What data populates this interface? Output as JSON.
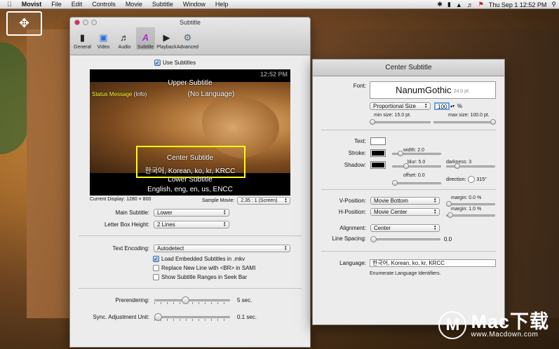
{
  "menubar": {
    "apple": "",
    "app": "Movist",
    "items": [
      "File",
      "Edit",
      "Controls",
      "Movie",
      "Subtitle",
      "Window",
      "Help"
    ],
    "clock": "Thu Sep 1  12:52 PM",
    "right_icons": [
      "bluetooth-icon",
      "battery-icon",
      "airplay-icon",
      "volume-icon",
      "flag-icon",
      "spotlight-icon"
    ]
  },
  "subtitle_window": {
    "title": "Subtitle",
    "toolbar": [
      {
        "label": "General",
        "icon": "switch-icon"
      },
      {
        "label": "Video",
        "icon": "monitor-icon"
      },
      {
        "label": "Audio",
        "icon": "speaker-icon"
      },
      {
        "label": "Subtitle",
        "icon": "subtitle-icon"
      },
      {
        "label": "Playback",
        "icon": "play-icon"
      },
      {
        "label": "Advanced",
        "icon": "gear-icon"
      }
    ],
    "use_subtitles": "Use Subtitles",
    "preview": {
      "clock": "12:52 PM",
      "upper": "Upper Subtitle",
      "upper2": "(No Language)",
      "status": "Status Message",
      "status_info": "(Info)",
      "center": "Center Subtitle",
      "center2": "한국어, Korean, ko, kr, KRCC",
      "lower": "Lower Subtitle",
      "lower2": "English, eng, en, us, ENCC"
    },
    "current_display": "Current Display: 1280 × 800",
    "sample_movie_label": "Sample Movie:",
    "sample_movie_value": "2.35 : 1 (Screen)",
    "main_subtitle_label": "Main Subtitle:",
    "main_subtitle_value": "Lower",
    "letterbox_label": "Letter Box Height:",
    "letterbox_value": "2 Lines",
    "encoding_label": "Text Encoding:",
    "encoding_value": "Autodetect",
    "load_mkv": "Load Embedded Subtitles in .mkv",
    "replace_br": "Replace New Line with <BR> in SAMI",
    "show_ranges": "Show Subtitle Ranges in Seek Bar",
    "prerendering_label": "Prerendering:",
    "prerendering_value": "5 sec.",
    "prerendering_level": 0.4,
    "sync_label": "Sync. Adjustment Unit:",
    "sync_value": "0.1 sec.",
    "sync_level": 0.0
  },
  "center_panel": {
    "title": "Center Subtitle",
    "font_label": "Font:",
    "font_name": "NanumGothic",
    "font_size": "24.0 pt.",
    "size_mode": "Proportional Size",
    "size_value": "100",
    "percent": "%",
    "min_size": "min size: 15.0 pt.",
    "max_size": "max size: 100.0 pt.",
    "text_label": "Text:",
    "stroke_label": "Stroke:",
    "shadow_label": "Shadow:",
    "text_color": "#ffffff",
    "stroke_color": "#000000",
    "shadow_color": "#000000",
    "width": "width: 2.0",
    "blur": "blur: 5.0",
    "darkness": "darkness: 3",
    "offset": "offset: 0.0",
    "direction": "direction:",
    "direction_value": "315°",
    "vpos_label": "V-Position:",
    "vpos_value": "Movie Bottom",
    "hpos_label": "H-Position:",
    "hpos_value": "Movie Center",
    "margin_v": "margin: 0.0 %",
    "margin_h": "margin: 1.0 %",
    "align_label": "Alignment:",
    "align_value": "Center",
    "line_spacing_label": "Line Spacing:",
    "line_spacing_value": "0.0",
    "language_label": "Language:",
    "language_value": "한국어, Korean, ko, kr, KRCC",
    "enumerate": "Enumerate Language Identifiers."
  },
  "watermark": {
    "circle": "M",
    "title": "Mac下载",
    "url": "www.Macdown.com"
  }
}
